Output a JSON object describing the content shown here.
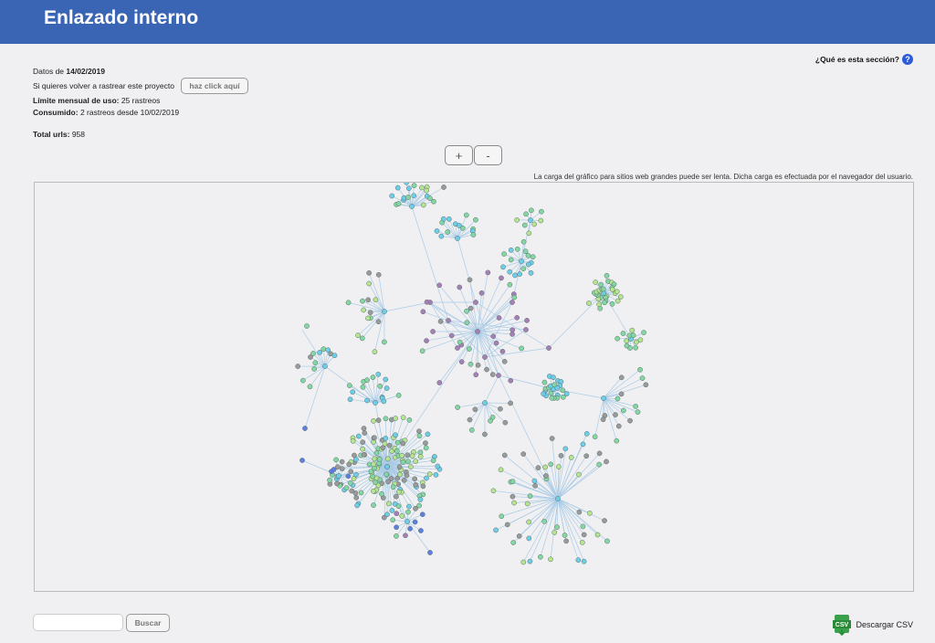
{
  "header": {
    "title": "Enlazado interno"
  },
  "info": {
    "data_label": "Datos de ",
    "data_date": "14/02/2019",
    "recrawl_text": "Si quieres volver a rastrear este proyecto",
    "recrawl_button": "haz click aquí",
    "limit_label": "Límite mensual de uso:",
    "limit_value": " 25 rastreos",
    "consumed_label": "Consumido:",
    "consumed_value": " 2 rastreos desde 10/02/2019",
    "total_label": "Total urls:",
    "total_value": " 958"
  },
  "help": {
    "label": "¿Qué es esta sección?",
    "icon": "?"
  },
  "zoom": {
    "in_label": "+",
    "out_label": "-"
  },
  "graph": {
    "note": "La carga del gráfico para sitios web grandes puede ser lenta. Dicha carga es efectuada por el navegador del usuario.",
    "colors": {
      "edge": "#a9cbe6",
      "purple": "#a57fb6",
      "gray": "#9a9a9a",
      "green": "#83d8a2",
      "cyan": "#6ccfe9",
      "blue": "#5c7fe0",
      "lightgreen": "#b5e58e"
    }
  },
  "footer": {
    "search_button": "Buscar",
    "csv_label": "Descargar CSV",
    "csv_icon_text": "CSV"
  }
}
